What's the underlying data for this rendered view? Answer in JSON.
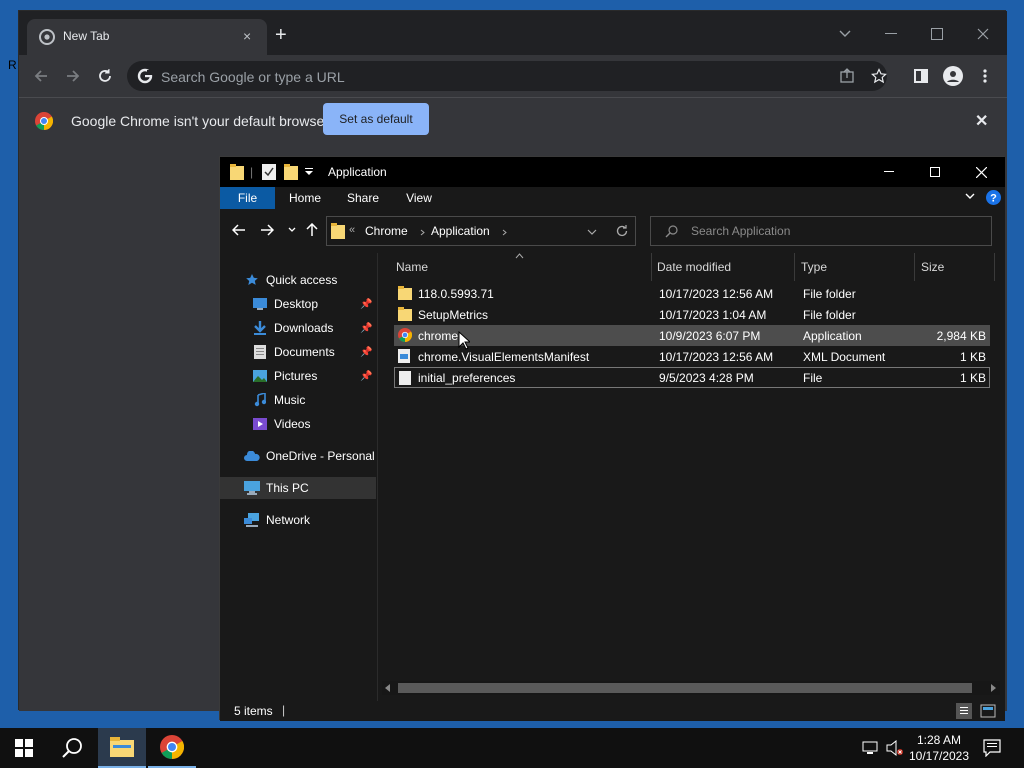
{
  "desktop": {
    "edge_text": "R"
  },
  "chrome": {
    "tab_title": "New Tab",
    "tab_close": "×",
    "new_tab": "+",
    "omnibox_placeholder": "Search Google or type a URL",
    "infobar_text": "Google Chrome isn't your default browser",
    "set_default_label": "Set as default",
    "infobar_close": "✕",
    "colors": {
      "bg": "#35363a",
      "tabstrip": "#202124",
      "accent": "#8ab4f8"
    }
  },
  "explorer": {
    "title": "Application",
    "ribbon_tabs": [
      "File",
      "Home",
      "Share",
      "View"
    ],
    "breadcrumb": [
      "Chrome",
      "Application"
    ],
    "breadcrumb_prefix": "«",
    "search_placeholder": "Search Application",
    "nav": {
      "quick_access": "Quick access",
      "desktop": "Desktop",
      "downloads": "Downloads",
      "documents": "Documents",
      "pictures": "Pictures",
      "music": "Music",
      "videos": "Videos",
      "onedrive": "OneDrive - Personal",
      "this_pc": "This PC",
      "network": "Network"
    },
    "columns": {
      "name": "Name",
      "date": "Date modified",
      "type": "Type",
      "size": "Size"
    },
    "files": [
      {
        "name": "118.0.5993.71",
        "date": "10/17/2023 12:56 AM",
        "type": "File folder",
        "size": "",
        "icon": "folder-icon"
      },
      {
        "name": "SetupMetrics",
        "date": "10/17/2023 1:04 AM",
        "type": "File folder",
        "size": "",
        "icon": "folder-icon"
      },
      {
        "name": "chrome",
        "date": "10/9/2023 6:07 PM",
        "type": "Application",
        "size": "2,984 KB",
        "icon": "chrome-icon"
      },
      {
        "name": "chrome.VisualElementsManifest",
        "date": "10/17/2023 12:56 AM",
        "type": "XML Document",
        "size": "1 KB",
        "icon": "xml-file-icon"
      },
      {
        "name": "initial_preferences",
        "date": "9/5/2023 4:28 PM",
        "type": "File",
        "size": "1 KB",
        "icon": "file-icon"
      }
    ],
    "status": "5 items",
    "colors": {
      "bg": "#191919",
      "file_tab": "#0b5aa3",
      "selected_row": "#4d4d4d"
    }
  },
  "taskbar": {
    "time": "1:28 AM",
    "date": "10/17/2023",
    "colors": {
      "bg": "#101010",
      "active_app": "#2b3a4d"
    }
  }
}
